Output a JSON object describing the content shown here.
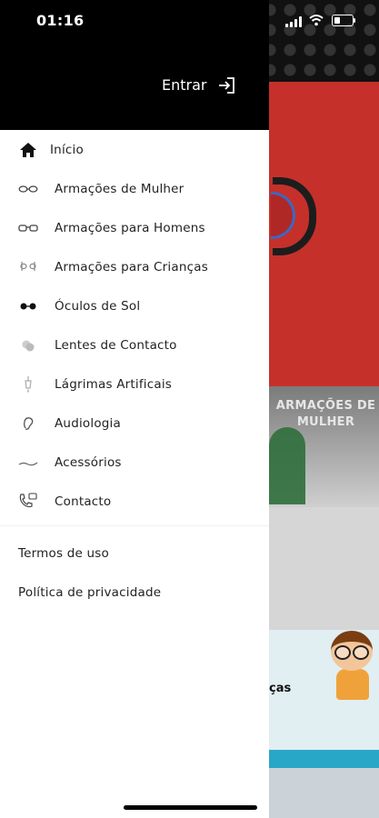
{
  "status_bar": {
    "time": "01:16"
  },
  "drawer": {
    "login_label": "Entrar",
    "menu": [
      {
        "label": "Início",
        "icon": "home-icon"
      },
      {
        "label": "Armações de Mulher",
        "icon": "women-glasses-icon"
      },
      {
        "label": "Armações para Homens",
        "icon": "men-glasses-icon"
      },
      {
        "label": "Armações para Crianças",
        "icon": "kids-glasses-icon"
      },
      {
        "label": "Óculos de Sol",
        "icon": "sunglasses-icon"
      },
      {
        "label": "Lentes de Contacto",
        "icon": "contact-lens-icon"
      },
      {
        "label": "Lágrimas Artificais",
        "icon": "eye-drops-icon"
      },
      {
        "label": "Audiologia",
        "icon": "ear-icon"
      },
      {
        "label": "Acessórios",
        "icon": "accessories-icon"
      },
      {
        "label": "Contacto",
        "icon": "phone-contact-icon"
      }
    ],
    "footer_links": [
      "Termos de uso",
      "Política de privacidade"
    ]
  },
  "background": {
    "banner_women": "ARMAÇÕES DE MULHER",
    "banner_kids_partial": "ças"
  },
  "colors": {
    "drawer_header": "#000000",
    "banner_red": "#c6302a"
  }
}
